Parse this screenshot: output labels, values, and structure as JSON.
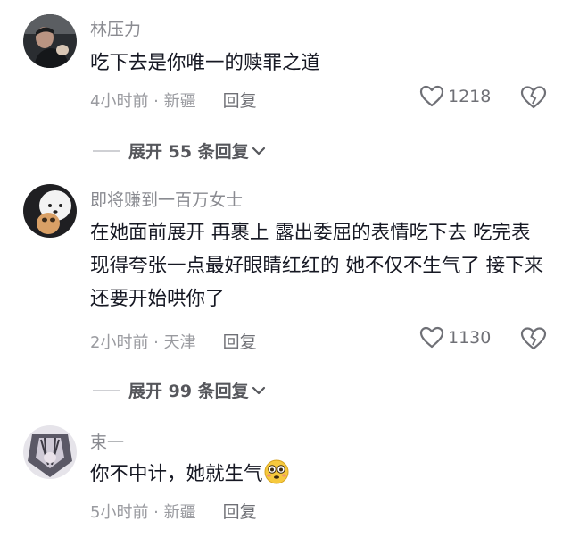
{
  "comments": [
    {
      "username": "林压力",
      "text": "吃下去是你唯一的赎罪之道",
      "time_location": "4小时前 · 新疆",
      "reply_label": "回复",
      "likes": "1218",
      "expand_label": "展开 55 条回复"
    },
    {
      "username": "即将赚到一百万女士",
      "text": "在她面前展开 再裹上 露出委屈的表情吃下去 吃完表现得夸张一点最好眼睛红红的 她不仅不生气了 接下来还要开始哄你了",
      "time_location": "2小时前 · 天津",
      "reply_label": "回复",
      "likes": "1130",
      "expand_label": "展开 99 条回复"
    },
    {
      "username": "束一",
      "text": "你不中计，她就生气",
      "time_location": "5小时前 · 新疆",
      "reply_label": "回复",
      "emoji": "flushed-face-emoji"
    }
  ],
  "colors": {
    "username": "#8a8b91",
    "text": "#161823",
    "meta": "#9a9ba0",
    "expand": "#56575c"
  }
}
